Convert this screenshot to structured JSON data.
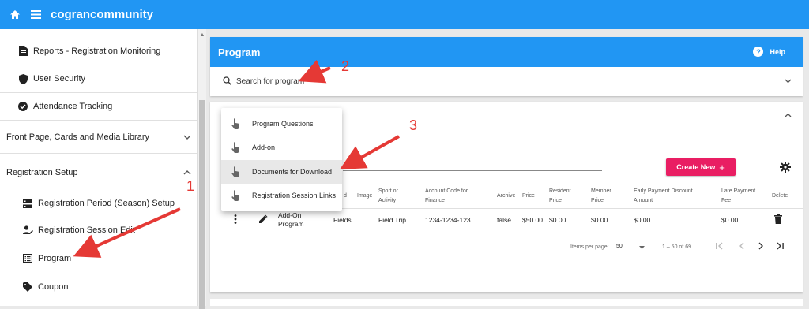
{
  "app": {
    "title": "cograncommunity",
    "accent": "#2196f3"
  },
  "sidebar": {
    "items": [
      {
        "label": "Reports - Registration Monitoring",
        "icon": "document-icon"
      },
      {
        "label": "User Security",
        "icon": "shield-icon"
      },
      {
        "label": "Attendance Tracking",
        "icon": "check-circle-icon"
      }
    ],
    "sections": [
      {
        "label": "Front Page, Cards and Media Library",
        "expanded": false
      },
      {
        "label": "Registration Setup",
        "expanded": true
      }
    ],
    "sub_items": [
      {
        "label": "Registration Period (Season) Setup",
        "icon": "server-icon"
      },
      {
        "label": "Registration Session Edit",
        "icon": "person-edit-icon"
      },
      {
        "label": "Program",
        "icon": "list-icon"
      },
      {
        "label": "Coupon",
        "icon": "tag-icon"
      }
    ]
  },
  "program_card": {
    "title": "Program",
    "help_label": "Help",
    "search_placeholder": "Search for program"
  },
  "toolbar": {
    "create_label": "Create New",
    "create_color": "#e91e63"
  },
  "menu": {
    "items": [
      {
        "label": "Program Questions"
      },
      {
        "label": "Add-on"
      },
      {
        "label": "Documents for Download",
        "highlighted": true
      },
      {
        "label": "Registration Session Links"
      }
    ]
  },
  "table": {
    "headers": {
      "d": "d",
      "image": "Image",
      "sport": [
        "Sport or",
        "Activity"
      ],
      "account": [
        "Account Code for",
        "Finance"
      ],
      "archive": "Archive",
      "price": "Price",
      "resident": [
        "Resident",
        "Price"
      ],
      "member": [
        "Member",
        "Price"
      ],
      "early": [
        "Early Payment Discount",
        "Amount"
      ],
      "late": [
        "Late Payment",
        "Fee"
      ],
      "delete": "Delete"
    },
    "row": {
      "name": [
        "Add-On",
        "Program"
      ],
      "field": "Fields",
      "sport": "Field Trip",
      "account": "1234-1234-123",
      "archive": "false",
      "price": "$50.00",
      "resident": "$0.00",
      "member": "$0.00",
      "early": "$0.00",
      "late": "$0.00"
    }
  },
  "pagination": {
    "items_per_page_label": "Items per page:",
    "per_page": "50",
    "range": "1 – 50 of 69"
  },
  "callouts": {
    "one": "1",
    "two": "2",
    "three": "3",
    "color": "#e53935"
  }
}
